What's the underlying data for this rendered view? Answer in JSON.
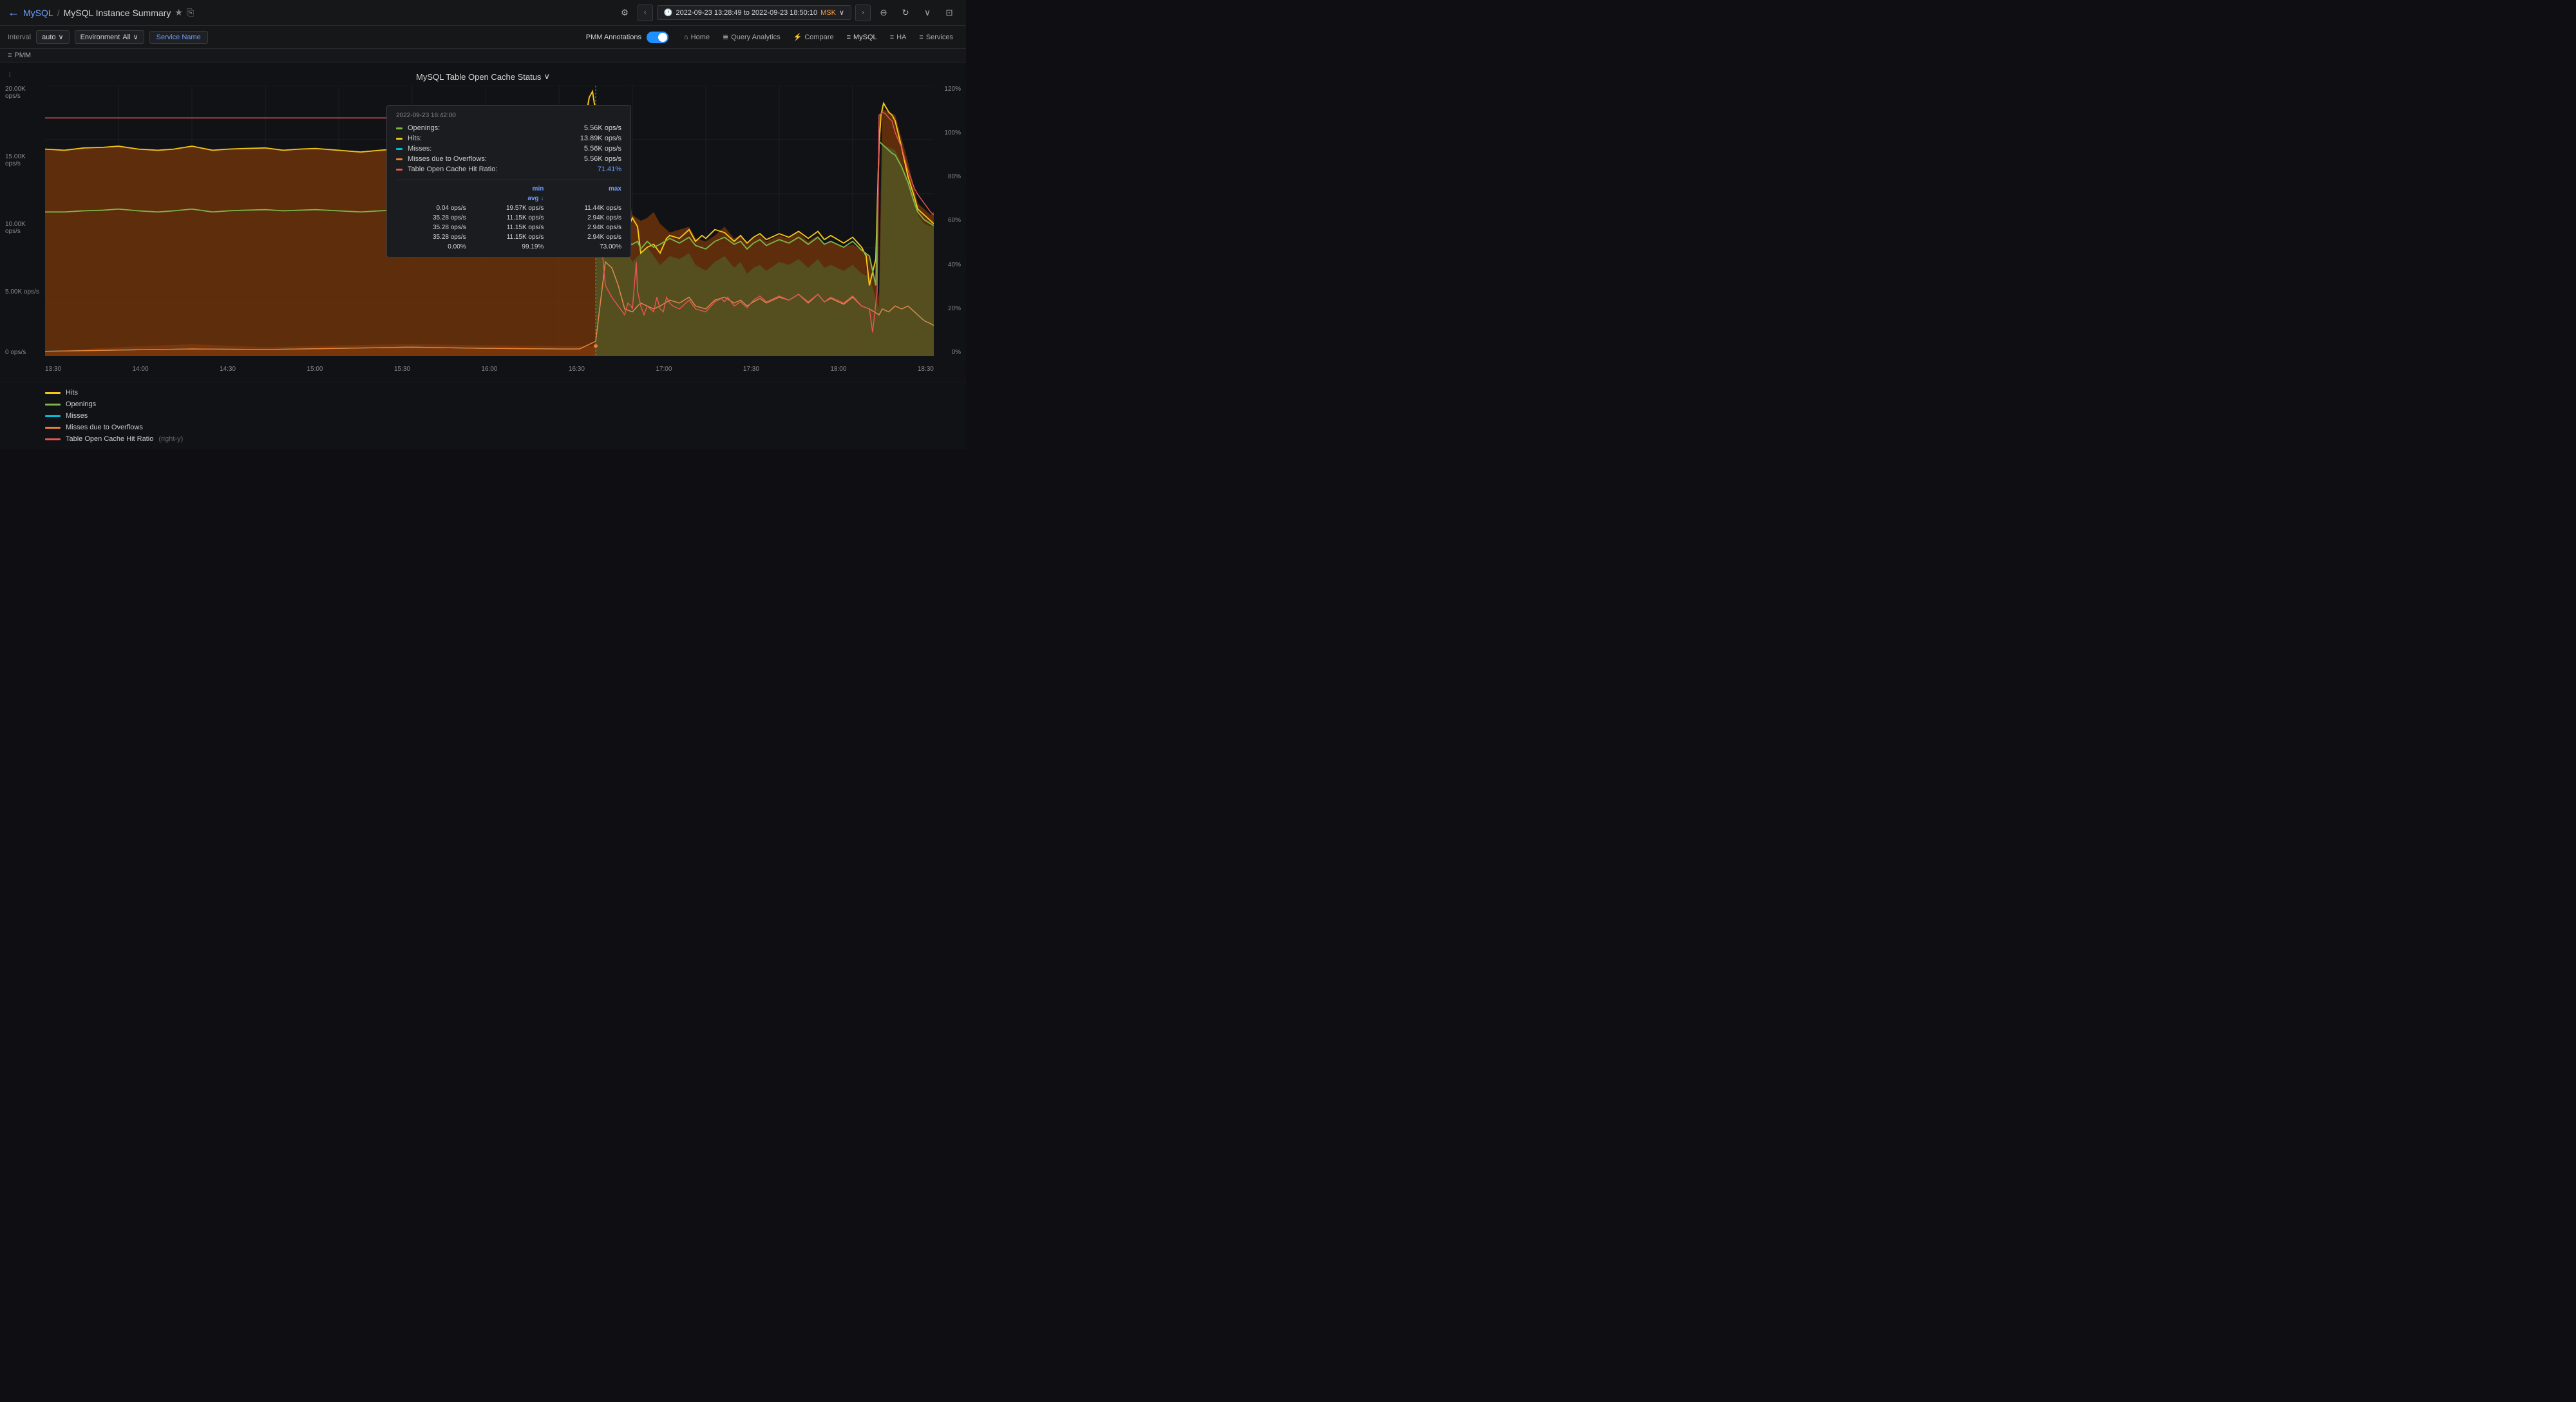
{
  "header": {
    "back_label": "←",
    "breadcrumb_parent": "MySQL",
    "breadcrumb_sep": "/",
    "breadcrumb_current": "MySQL Instance Summary",
    "star_icon": "★",
    "share_icon": "⎘",
    "settings_icon": "⚙",
    "nav_prev": "‹",
    "time_range": "2022-09-23 13:28:49 to 2022-09-23 18:50:10",
    "timezone": "MSK",
    "nav_next": "›",
    "zoom_icon": "⊖",
    "refresh_icon": "↻",
    "chevron_icon": "∨",
    "tv_icon": "⊡"
  },
  "sub_toolbar": {
    "interval_label": "Interval",
    "interval_value": "auto",
    "environment_label": "Environment",
    "environment_value": "All",
    "service_name_label": "Service Name",
    "pmm_annotations_label": "PMM Annotations"
  },
  "nav_links": [
    {
      "id": "home",
      "label": "Home",
      "icon": "🏠"
    },
    {
      "id": "query-analytics",
      "label": "Query Analytics",
      "icon": "≡≡"
    },
    {
      "id": "compare",
      "label": "Compare",
      "icon": "⚡"
    },
    {
      "id": "mysql",
      "label": "MySQL",
      "icon": "≡"
    },
    {
      "id": "ha",
      "label": "HA",
      "icon": "≡"
    },
    {
      "id": "services",
      "label": "Services",
      "icon": "≡"
    }
  ],
  "pmm_bar": {
    "icon": "≡",
    "label": "PMM"
  },
  "chart": {
    "title": "MySQL Table Open Cache Status",
    "title_arrow": "∨",
    "info_icon": "i",
    "y_left_labels": [
      "20.00K ops/s",
      "15.00K ops/s",
      "10.00K ops/s",
      "5.00K ops/s",
      "0 ops/s"
    ],
    "y_right_labels": [
      "120%",
      "100%",
      "80%",
      "60%",
      "40%",
      "20%",
      "0%"
    ],
    "x_labels": [
      "13:30",
      "14:00",
      "14:30",
      "15:00",
      "15:30",
      "16:00",
      "16:30",
      "17:00",
      "17:30",
      "18:00",
      "18:30"
    ],
    "tooltip": {
      "header": "2022-09-23 16:42:00",
      "rows": [
        {
          "label": "Openings:",
          "value": "5.56K ops/s",
          "color": "#7ab648"
        },
        {
          "label": "Hits:",
          "value": "13.89K ops/s",
          "color": "#f5c518"
        },
        {
          "label": "Misses:",
          "value": "5.56K ops/s",
          "color": "#00bcd4"
        },
        {
          "label": "Misses due to Overflows:",
          "value": "5.56K ops/s",
          "color": "#e8823a"
        },
        {
          "label": "Table Open Cache Hit Ratio:",
          "value": "71.41%",
          "color": "#e85454"
        }
      ],
      "stats": {
        "headers": [
          "min",
          "max",
          "avg ↓"
        ],
        "rows": [
          [
            "0.04 ops/s",
            "19.57K ops/s",
            "11.44K ops/s"
          ],
          [
            "35.28 ops/s",
            "11.15K ops/s",
            "2.94K ops/s"
          ],
          [
            "35.28 ops/s",
            "11.15K ops/s",
            "2.94K ops/s"
          ],
          [
            "35.28 ops/s",
            "11.15K ops/s",
            "2.94K ops/s"
          ],
          [
            "0.00%",
            "99.19%",
            "73.00%"
          ]
        ]
      }
    }
  },
  "legend": [
    {
      "id": "hits",
      "label": "Hits",
      "color": "#f5c518",
      "type": "line"
    },
    {
      "id": "openings",
      "label": "Openings",
      "color": "#7ab648",
      "type": "line"
    },
    {
      "id": "misses",
      "label": "Misses",
      "color": "#00bcd4",
      "type": "line"
    },
    {
      "id": "misses-overflow",
      "label": "Misses due to Overflows",
      "color": "#e8823a",
      "type": "line"
    },
    {
      "id": "hit-ratio",
      "label": "Table Open Cache Hit Ratio",
      "sublabel": "(right-y)",
      "color": "#e85454",
      "type": "line"
    }
  ]
}
